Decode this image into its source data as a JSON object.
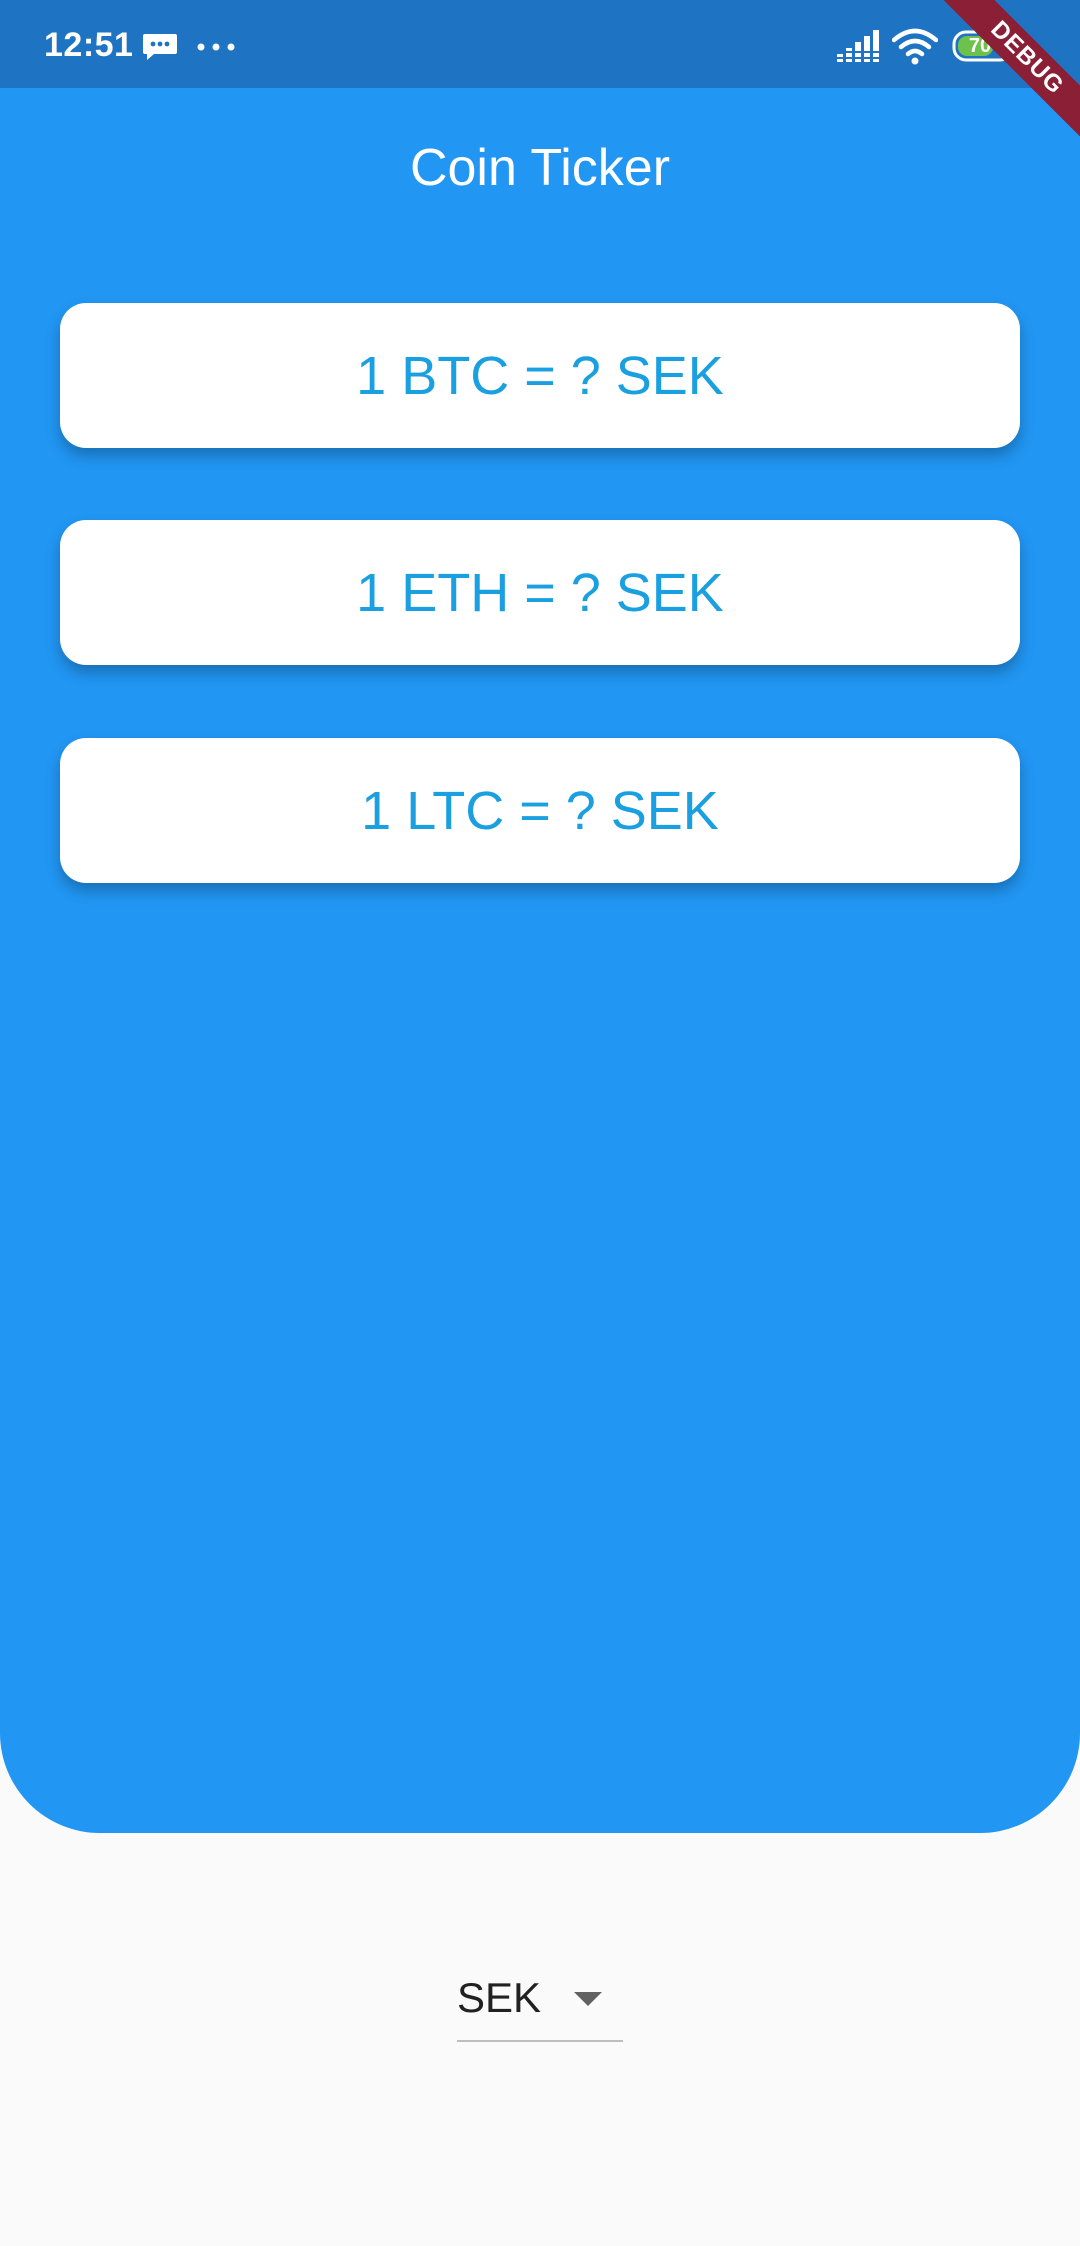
{
  "status_bar": {
    "time": "12:51",
    "battery_level": "70",
    "icons": [
      "message-icon",
      "more-dots-icon",
      "signal-icon",
      "wifi-icon",
      "battery-icon"
    ]
  },
  "debug_banner": {
    "label": "DEBUG"
  },
  "app": {
    "title": "Coin Ticker",
    "cards": [
      {
        "label": "1 BTC = ? SEK"
      },
      {
        "label": "1 ETH = ? SEK"
      },
      {
        "label": "1 LTC = ? SEK"
      }
    ]
  },
  "currency_picker": {
    "selected": "SEK",
    "icon": "dropdown-arrow-icon"
  },
  "colors": {
    "status_bar": "#1e74c2",
    "primary": "#2196f3",
    "card_text": "#1a9fe0",
    "card_background": "#ffffff",
    "page_background": "#fafafa",
    "debug_banner": "#8a1f36",
    "battery_fill": "#6cc24a"
  }
}
